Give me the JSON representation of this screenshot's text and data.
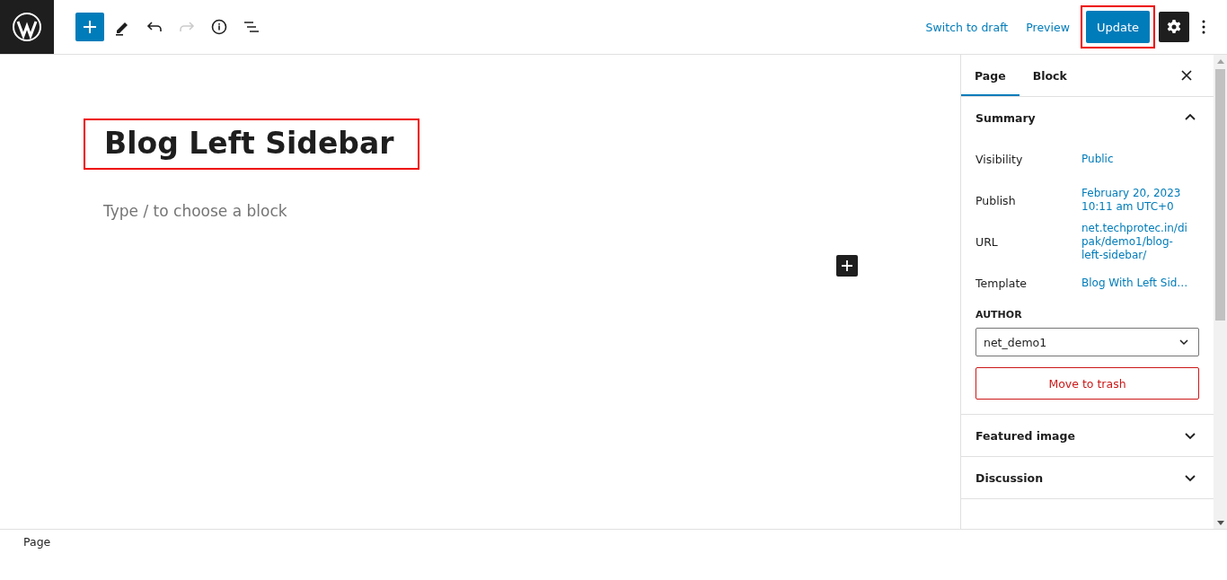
{
  "toolbar": {
    "tools": [
      {
        "kind": "add",
        "selected": true,
        "disabled": false
      },
      {
        "kind": "pen",
        "selected": false,
        "disabled": false
      },
      {
        "kind": "undo",
        "selected": false,
        "disabled": false
      },
      {
        "kind": "redo",
        "selected": false,
        "disabled": true
      },
      {
        "kind": "info",
        "selected": false,
        "disabled": false
      },
      {
        "kind": "list",
        "selected": false,
        "disabled": false
      }
    ],
    "links": [
      "Switch to draft",
      "Preview"
    ],
    "update_button": {
      "label": "Update",
      "highlighted": true
    },
    "settings_selected": true
  },
  "editor": {
    "title": "Blog Left Sidebar",
    "title_highlighted": true,
    "placeholder": "Type / to choose a block"
  },
  "sidebar": {
    "tabs": [
      {
        "label": "Page",
        "selected": true
      },
      {
        "label": "Block",
        "selected": false
      }
    ],
    "panels": [
      {
        "title": "Summary",
        "expanded": true,
        "rows": [
          {
            "label": "Visibility",
            "value": "Public"
          },
          {
            "label": "Publish",
            "value": "February 20, 2023 10:11 am UTC+0"
          },
          {
            "label": "URL",
            "value": "net.techprotec.in/dipak/demo1/blog-left-sidebar/"
          },
          {
            "label": "Template",
            "value": "Blog With Left Sid…"
          }
        ],
        "author_label": "AUTHOR",
        "author": "net_demo1",
        "trash": "Move to trash"
      },
      {
        "title": "Featured image",
        "expanded": false
      },
      {
        "title": "Discussion",
        "expanded": false
      }
    ]
  },
  "status_bar": {
    "breadcrumb": "Page"
  }
}
